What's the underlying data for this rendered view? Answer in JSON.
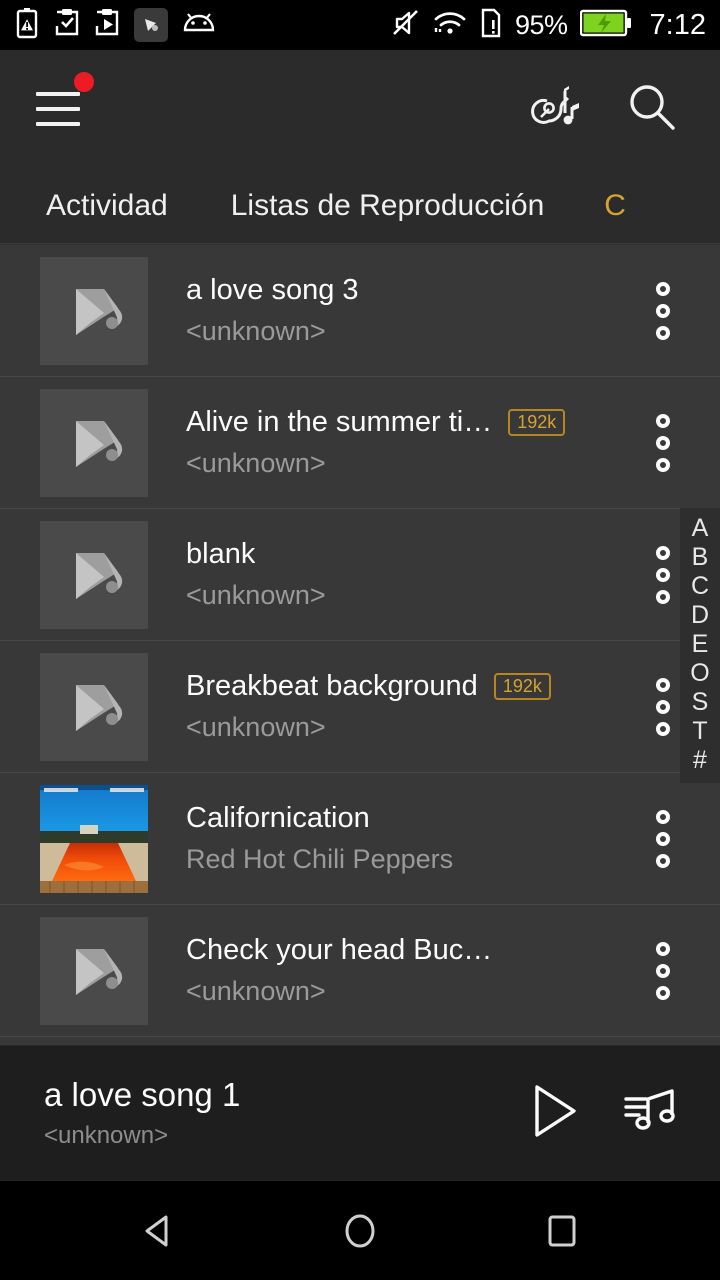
{
  "status_bar": {
    "icons_left": [
      "battery-warning-icon",
      "clipboard-check-icon",
      "clipboard-play-icon",
      "app-badge-icon",
      "android-icon"
    ],
    "icons_right": [
      "mute-icon",
      "wifi-icon",
      "sim-alert-icon"
    ],
    "battery_percent": "95%",
    "battery_icon": "battery-charging-icon",
    "time": "7:12"
  },
  "app_bar": {
    "menu_icon": "hamburger-menu-icon",
    "menu_has_notification": true,
    "notification_dot_color": "#ed1c24",
    "guitar_icon": "guitar-music-icon",
    "search_icon": "search-icon"
  },
  "tabs": {
    "items": [
      {
        "label": "Actividad",
        "selected": false
      },
      {
        "label": "Listas de Reproducción",
        "selected": false
      },
      {
        "label": "C",
        "selected": true,
        "partial": true
      }
    ],
    "accent_color": "#d6a32e"
  },
  "songs": [
    {
      "title": "a love song 3",
      "artist": "<unknown>",
      "bitrate": "",
      "art": "default"
    },
    {
      "title": "Alive in the summer ti…",
      "artist": "<unknown>",
      "bitrate": "192k",
      "art": "default"
    },
    {
      "title": "blank",
      "artist": "<unknown>",
      "bitrate": "",
      "art": "default"
    },
    {
      "title": "Breakbeat background",
      "artist": "<unknown>",
      "bitrate": "192k",
      "art": "default"
    },
    {
      "title": "Californication",
      "artist": "Red Hot Chili Peppers",
      "bitrate": "",
      "art": "californication"
    },
    {
      "title": "Check your head   Buc…",
      "artist": "<unknown>",
      "bitrate": "",
      "art": "default"
    }
  ],
  "overflow_icon": "more-vertical-icon",
  "alpha_index": {
    "letters": [
      "A",
      "B",
      "C",
      "D",
      "E",
      "O",
      "S",
      "T",
      "#"
    ]
  },
  "now_playing": {
    "title": "a love song 1",
    "artist": "<unknown>",
    "play_icon": "play-icon",
    "queue_icon": "queue-music-icon"
  },
  "nav_bar": {
    "back_icon": "back-triangle-icon",
    "home_icon": "home-circle-icon",
    "recents_icon": "recents-square-icon"
  }
}
